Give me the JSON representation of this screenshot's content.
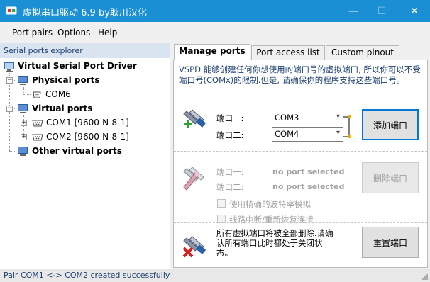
{
  "window": {
    "title": "虚拟串口驱动 6.9 by耿川汉化",
    "minimize_glyph": "—",
    "maximize_glyph": "☐",
    "close_glyph": "✕"
  },
  "menu": [
    "Port pairs",
    "Options",
    "Help"
  ],
  "explorer": {
    "header": "Serial ports explorer",
    "root": "Virtual Serial Port Driver",
    "physical": {
      "label": "Physical ports",
      "children": [
        "COM6"
      ]
    },
    "virtual": {
      "label": "Virtual ports",
      "children": [
        "COM1 [9600-N-8-1]",
        "COM2 [9600-N-8-1]"
      ]
    },
    "other": {
      "label": "Other virtual ports"
    }
  },
  "tabs": [
    {
      "label": "Manage ports",
      "active": true
    },
    {
      "label": "Port access list",
      "active": false
    },
    {
      "label": "Custom pinout",
      "active": false
    }
  ],
  "manage": {
    "description": "VSPD 能够创建任何你想使用的端口号的虚拟端口, 所以你可以不受端口号(COMx)的限制.但是, 请确保你的程序支持这些端口号。",
    "add": {
      "port1_label": "端口一:",
      "port2_label": "端口二:",
      "port1_value": "COM3",
      "port2_value": "COM4",
      "button": "添加端口",
      "icon": "add-pair-icon"
    },
    "remove": {
      "port1_label": "端口一:",
      "port2_label": "端口二:",
      "port1_value": "no port selected",
      "port2_value": "no port selected",
      "button": "删除端口",
      "option_baud": "使用精确的波特率模拟",
      "option_reconnect": "线路中断/重新恢复连接",
      "icon": "remove-pair-icon"
    },
    "reset": {
      "text": "所有虚拟端口将被全部删除.请确认所有端口此时都处于关闭状态。",
      "button": "重置端口",
      "icon": "reset-ports-icon"
    }
  },
  "status": "Pair COM1 <-> COM2 created successfully",
  "colors": {
    "titlebar": "#1a8fd4",
    "accent": "#0078d7",
    "explorer_header": "#d9e4f0",
    "text_blue": "#1d3f73"
  }
}
